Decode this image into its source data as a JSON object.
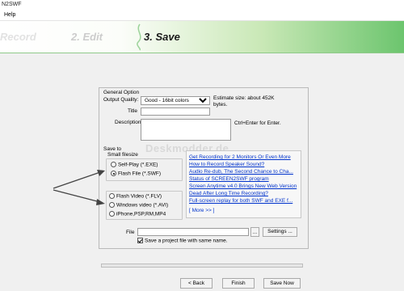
{
  "window": {
    "title": "N2SWF"
  },
  "menu": {
    "items": [
      {
        "label": "Help"
      }
    ]
  },
  "steps": [
    {
      "label": "Record"
    },
    {
      "label": "2. Edit"
    },
    {
      "label": "3. Save"
    }
  ],
  "general": {
    "heading": "General Option",
    "quality_label": "Output Quality:",
    "quality_value": "Good - 16bit colors",
    "estimate": "Estimate size: about 452K bytes.",
    "title_label": "Title",
    "title_value": "",
    "description_label": "Description",
    "description_value": "",
    "description_hint": "Ctrl+Enter for Enter."
  },
  "saveto": {
    "heading": "Save to",
    "small_label": "Small filesize",
    "small_options": [
      {
        "label": "Self-Play (*.EXE)",
        "checked": false
      },
      {
        "label": "Flash File (*.SWF)",
        "checked": true
      }
    ],
    "other_options": [
      {
        "label": "Flash Video (*.FLV)",
        "checked": false
      },
      {
        "label": "Windows video (*.AVI)",
        "checked": false
      },
      {
        "label": "iPhone,PSP,RM,MP4",
        "checked": false
      }
    ]
  },
  "links": {
    "items": [
      "Get Recording for 2 Monitors Or Even More",
      "How to Record Speaker Sound?",
      "Audio Re-dub, The Second Chance to Cha...",
      "Status of SCREEN2SWF program",
      "Screen Anytime v4.0 Brings New Web Version",
      "Dead After Long Time Recording?",
      "Full-screen replay for both SWF and EXE f..."
    ],
    "more": "[ More >> ]"
  },
  "file": {
    "label": "File",
    "value": "",
    "browse": "...",
    "settings": "Settings ...",
    "save_project_label": "Save a project file with same name.",
    "save_project_checked": true
  },
  "watermark": "Deskmodder.de",
  "buttons": {
    "back": "< Back",
    "finish": "Finish",
    "save_now": "Save Now"
  },
  "colors": {
    "banner_green": "#6cc56e",
    "link": "#0033cc",
    "arrow": "#444444"
  }
}
